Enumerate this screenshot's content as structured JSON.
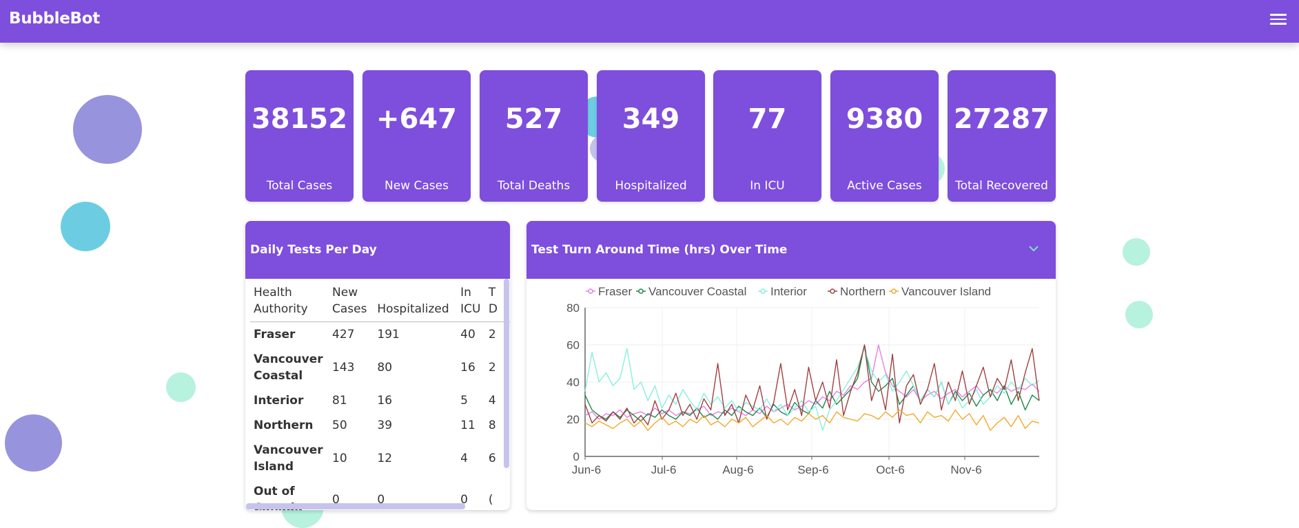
{
  "app": {
    "title": "BubbleBot"
  },
  "stats": [
    {
      "value": "38152",
      "label": "Total Cases"
    },
    {
      "value": "+647",
      "label": "New Cases"
    },
    {
      "value": "527",
      "label": "Total Deaths"
    },
    {
      "value": "349",
      "label": "Hospitalized"
    },
    {
      "value": "77",
      "label": "In ICU"
    },
    {
      "value": "9380",
      "label": "Active Cases"
    },
    {
      "value": "27287",
      "label": "Total Recovered"
    }
  ],
  "tests_panel": {
    "title": "Daily Tests Per Day",
    "columns": [
      "Health Authority",
      "New Cases",
      "Hospitalized",
      "In ICU",
      "T D"
    ],
    "rows": [
      {
        "name": "Fraser",
        "new_cases": "427",
        "hospitalized": "191",
        "icu": "40",
        "extra": "2"
      },
      {
        "name": "Vancouver Coastal",
        "new_cases": "143",
        "hospitalized": "80",
        "icu": "16",
        "extra": "2"
      },
      {
        "name": "Interior",
        "new_cases": "81",
        "hospitalized": "16",
        "icu": "5",
        "extra": "4"
      },
      {
        "name": "Northern",
        "new_cases": "50",
        "hospitalized": "39",
        "icu": "11",
        "extra": "8"
      },
      {
        "name": "Vancouver Island",
        "new_cases": "10",
        "hospitalized": "12",
        "icu": "4",
        "extra": "6"
      },
      {
        "name": "Out of Canada",
        "new_cases": "0",
        "hospitalized": "0",
        "icu": "0",
        "extra": "("
      }
    ]
  },
  "turnaround_panel": {
    "title": "Test Turn Around Time (hrs) Over Time",
    "toggle_icon": "chevron-down-icon"
  },
  "colors": {
    "brand": "#7e4edc",
    "bubble_purple": "#9793dc",
    "bubble_blue": "#6ccde2",
    "bubble_mint": "#b6f2dd"
  },
  "chart_data": {
    "type": "line",
    "title": "",
    "xlabel": "",
    "ylabel": "",
    "ylim": [
      0,
      80
    ],
    "yticks": [
      0,
      20,
      40,
      60,
      80
    ],
    "xticks": [
      "Jun-6",
      "Jul-6",
      "Aug-6",
      "Sep-6",
      "Oct-6",
      "Nov-6"
    ],
    "grid": true,
    "legend": "top",
    "series": [
      {
        "name": "Fraser",
        "color": "#e87de8",
        "values": [
          22,
          24,
          20,
          23,
          22,
          25,
          21,
          23,
          24,
          22,
          26,
          23,
          25,
          22,
          24,
          23,
          25,
          27,
          22,
          24,
          23,
          26,
          24,
          22,
          25,
          23,
          27,
          24,
          26,
          28,
          25,
          27,
          30,
          28,
          32,
          30,
          35,
          33,
          38,
          36,
          40,
          42,
          60,
          45,
          38,
          35,
          32,
          36,
          30,
          33,
          35,
          31,
          34,
          36,
          32,
          35,
          38,
          33,
          36,
          34,
          38,
          35,
          37,
          36,
          39,
          35
        ]
      },
      {
        "name": "Vancouver Coastal",
        "color": "#1a8a4a",
        "values": [
          33,
          25,
          22,
          20,
          24,
          21,
          25,
          22,
          19,
          23,
          21,
          25,
          22,
          20,
          24,
          22,
          26,
          21,
          23,
          20,
          25,
          22,
          27,
          24,
          22,
          26,
          21,
          28,
          24,
          22,
          29,
          25,
          23,
          30,
          26,
          35,
          28,
          32,
          36,
          42,
          60,
          40,
          35,
          38,
          42,
          28,
          33,
          38,
          30,
          36,
          32,
          40,
          28,
          35,
          30,
          34,
          27,
          33,
          36,
          30,
          38,
          28,
          35,
          25,
          33,
          30
        ]
      },
      {
        "name": "Interior",
        "color": "#86f0dc",
        "values": [
          35,
          56,
          40,
          45,
          38,
          42,
          58,
          36,
          40,
          30,
          38,
          26,
          33,
          28,
          36,
          30,
          25,
          34,
          28,
          32,
          26,
          30,
          24,
          29,
          27,
          25,
          31,
          24,
          28,
          22,
          26,
          30,
          24,
          27,
          14,
          25,
          30,
          36,
          42,
          48,
          58,
          46,
          40,
          44,
          35,
          40,
          46,
          38,
          30,
          36,
          32,
          40,
          28,
          34,
          26,
          30,
          36,
          28,
          32,
          38,
          34,
          40,
          36,
          42,
          38,
          41
        ]
      },
      {
        "name": "Northern",
        "color": "#a04040",
        "values": [
          28,
          18,
          22,
          19,
          24,
          20,
          26,
          18,
          22,
          17,
          30,
          20,
          25,
          34,
          22,
          28,
          20,
          31,
          25,
          50,
          22,
          28,
          18,
          33,
          25,
          38,
          20,
          29,
          50,
          25,
          36,
          22,
          48,
          30,
          40,
          26,
          52,
          22,
          35,
          45,
          60,
          30,
          42,
          25,
          55,
          18,
          38,
          44,
          28,
          36,
          50,
          25,
          40,
          30,
          46,
          28,
          38,
          48,
          32,
          42,
          36,
          52,
          30,
          45,
          58,
          30
        ]
      },
      {
        "name": "Vancouver Island",
        "color": "#f2a92a",
        "values": [
          18,
          16,
          19,
          17,
          15,
          18,
          20,
          16,
          19,
          14,
          18,
          21,
          17,
          19,
          16,
          20,
          18,
          22,
          17,
          19,
          16,
          20,
          18,
          21,
          16,
          19,
          22,
          18,
          20,
          17,
          21,
          19,
          23,
          20,
          22,
          18,
          24,
          21,
          20,
          19,
          23,
          22,
          20,
          24,
          21,
          25,
          22,
          23,
          18,
          24,
          21,
          22,
          19,
          25,
          20,
          23,
          17,
          22,
          14,
          18,
          21,
          16,
          22,
          15,
          19,
          18
        ]
      }
    ]
  }
}
